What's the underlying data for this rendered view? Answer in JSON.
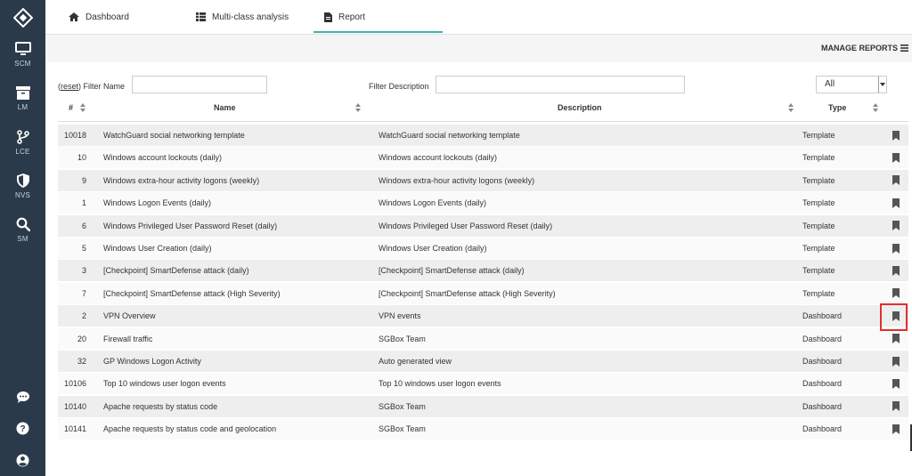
{
  "sidebar": {
    "items": [
      {
        "label": "SCM",
        "icon": "monitor-icon"
      },
      {
        "label": "LM",
        "icon": "archive-icon"
      },
      {
        "label": "LCE",
        "icon": "branch-icon"
      },
      {
        "label": "NVS",
        "icon": "shield-icon"
      },
      {
        "label": "SM",
        "icon": "search-icon"
      }
    ],
    "bottom_icons": [
      "chat-icon",
      "help-icon",
      "user-icon"
    ]
  },
  "tabs": [
    {
      "label": "Dashboard",
      "icon": "home-icon"
    },
    {
      "label": "Multi-class analysis",
      "icon": "table-icon"
    },
    {
      "label": "Report",
      "icon": "document-icon",
      "active": true
    }
  ],
  "manage_reports": "MANAGE REPORTS",
  "filters": {
    "reset": "reset",
    "name_label": "Filter Name",
    "name_value": "",
    "desc_label": "Filter Description",
    "desc_value": "",
    "type_selected": "All"
  },
  "columns": {
    "num": "#",
    "name": "Name",
    "description": "Description",
    "type": "Type"
  },
  "rows": [
    {
      "num": "10018",
      "name": "WatchGuard social networking template",
      "description": "WatchGuard social networking template",
      "type": "Template"
    },
    {
      "num": "10",
      "name": "Windows account lockouts (daily)",
      "description": "Windows account lockouts (daily)",
      "type": "Template"
    },
    {
      "num": "9",
      "name": "Windows extra-hour activity logons (weekly)",
      "description": "Windows extra-hour activity logons (weekly)",
      "type": "Template"
    },
    {
      "num": "1",
      "name": "Windows Logon Events (daily)",
      "description": "Windows Logon Events (daily)",
      "type": "Template"
    },
    {
      "num": "6",
      "name": "Windows Privileged User Password Reset (daily)",
      "description": "Windows Privileged User Password Reset (daily)",
      "type": "Template"
    },
    {
      "num": "5",
      "name": "Windows User Creation (daily)",
      "description": "Windows User Creation (daily)",
      "type": "Template"
    },
    {
      "num": "3",
      "name": "[Checkpoint] SmartDefense attack (daily)",
      "description": "[Checkpoint] SmartDefense attack (daily)",
      "type": "Template"
    },
    {
      "num": "7",
      "name": "[Checkpoint] SmartDefense attack (High Severity)",
      "description": "[Checkpoint] SmartDefense attack (High Severity)",
      "type": "Template"
    },
    {
      "num": "2",
      "name": "VPN Overview",
      "description": "VPN events",
      "type": "Dashboard"
    },
    {
      "num": "20",
      "name": "Firewall traffic",
      "description": "SGBox Team",
      "type": "Dashboard"
    },
    {
      "num": "32",
      "name": "GP Windows Logon Activity",
      "description": "Auto generated view",
      "type": "Dashboard"
    },
    {
      "num": "10106",
      "name": "Top 10 windows user logon events",
      "description": "Top 10 windows user logon events",
      "type": "Dashboard"
    },
    {
      "num": "10140",
      "name": "Apache requests by status code",
      "description": "SGBox Team",
      "type": "Dashboard"
    },
    {
      "num": "10141",
      "name": "Apache requests by status code and geolocation",
      "description": "SGBox Team",
      "type": "Dashboard"
    }
  ],
  "colors": {
    "sidebar": "#2b3a4a",
    "accent": "#3bb3b0",
    "highlight": "#e03030"
  }
}
